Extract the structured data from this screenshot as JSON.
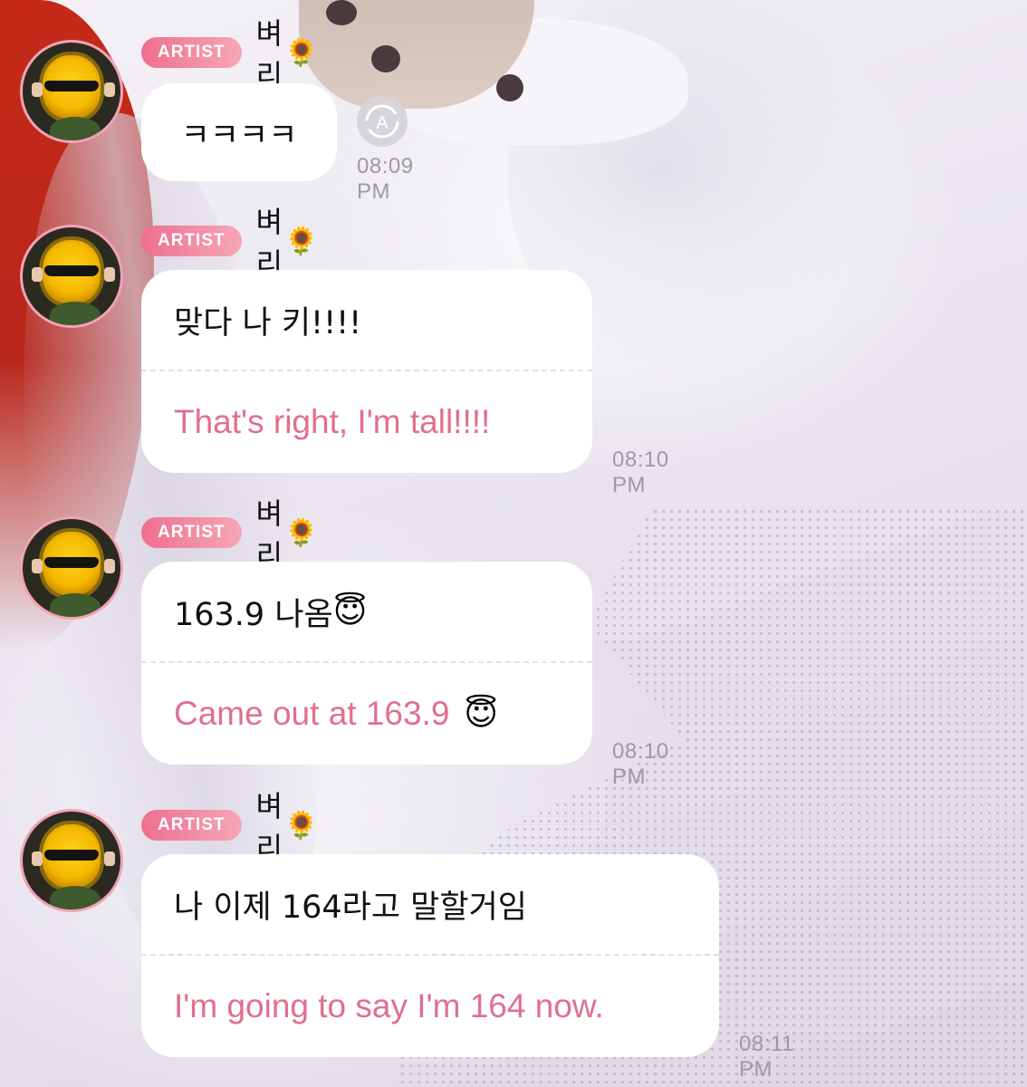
{
  "badge_label": "ARTIST",
  "messages": [
    {
      "sender": "벼리",
      "sender_emoji": "🌻",
      "original": "ㅋㅋㅋㅋ",
      "translation": "",
      "time": "08:09 PM",
      "has_translate_button": true
    },
    {
      "sender": "벼리",
      "sender_emoji": "🌻",
      "original": "맞다 나 키!!!!",
      "translation": "That's right, I'm tall!!!!",
      "time": "08:10 PM"
    },
    {
      "sender": "벼리",
      "sender_emoji": "🌻",
      "original": "163.9 나옴",
      "original_emoji": "😇",
      "translation": "Came out at 163.9",
      "translation_emoji": "😇",
      "time": "08:10 PM"
    },
    {
      "sender": "벼리",
      "sender_emoji": "🌻",
      "original": "나 이제 164라고 말할거임",
      "translation": "I'm going to say I'm 164 now.",
      "time": "08:11 PM"
    }
  ],
  "colors": {
    "badge": "#ee6f8f",
    "translation_text": "#e0708c",
    "time_text": "#9d98a2",
    "avatar_ring": "#f2a2b8"
  },
  "icons": {
    "translate_button": "auto-translate-icon",
    "avatar": "sunflower-with-sunglasses-avatar"
  }
}
